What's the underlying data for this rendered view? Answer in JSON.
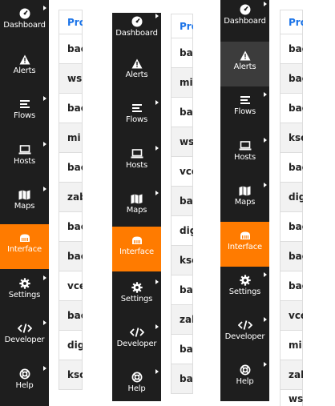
{
  "nav": {
    "dashboard": "Dashboard",
    "alerts": "Alerts",
    "flows": "Flows",
    "hosts": "Hosts",
    "maps": "Maps",
    "interface": "Interface",
    "settings": "Settings",
    "developer": "Developer",
    "help": "Help"
  },
  "colors": {
    "sidebar_bg": "#1e1e1e",
    "active_bg": "#ff7b00",
    "hover_bg": "#3c3c3c",
    "header_link": "#1a73e8"
  },
  "panels": [
    {
      "header": "Pro",
      "rows": [
        "bac",
        "ws",
        "bac",
        "mi",
        "bac",
        "zab",
        "bac",
        "bac",
        "vce",
        "bac",
        "dig",
        "ksc"
      ]
    },
    {
      "header": "Pro",
      "rows": [
        "bac",
        "mi",
        "bac",
        "ws",
        "vce",
        "bac",
        "dig",
        "ksc",
        "bac",
        "zab",
        "bac",
        "bac"
      ]
    },
    {
      "header": "Pro",
      "rows": [
        "bac",
        "bac",
        "bac",
        "ksc",
        "bac",
        "dig",
        "bac",
        "bac",
        "bac",
        "vce",
        "mi",
        "zab",
        "wsi"
      ]
    }
  ]
}
